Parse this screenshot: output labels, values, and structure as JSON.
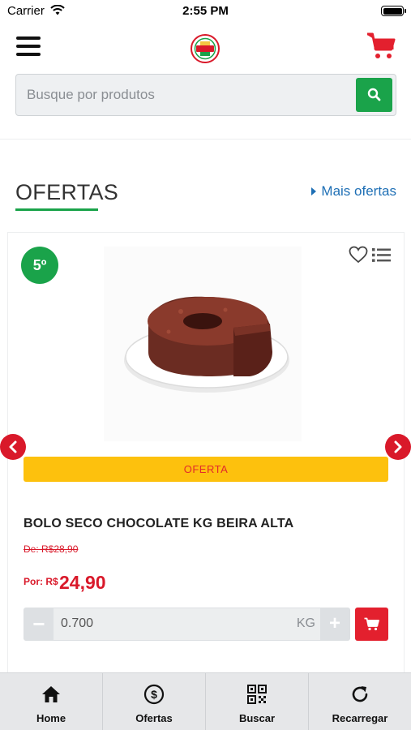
{
  "status_bar": {
    "carrier": "Carrier",
    "time": "2:55 PM"
  },
  "header": {
    "menu_icon": "hamburger-icon",
    "cart_icon": "cart-icon",
    "logo": "store-logo"
  },
  "search": {
    "placeholder": "Busque por produtos",
    "value": ""
  },
  "section": {
    "title": "OFERTAS",
    "more_link": "Mais ofertas"
  },
  "product": {
    "rank": "5º",
    "name": "BOLO SECO CHOCOLATE KG BEIRA ALTA",
    "offer_label": "OFERTA",
    "old_price": "De: R$28,90",
    "price_prefix": "Por: R$",
    "price": "24,90",
    "quantity": "0.700",
    "unit": "KG",
    "minus_label": "−",
    "plus_label": "+"
  },
  "tabs": [
    {
      "label": "Home",
      "icon": "home-icon"
    },
    {
      "label": "Ofertas",
      "icon": "dollar-icon"
    },
    {
      "label": "Buscar",
      "icon": "qr-code-icon"
    },
    {
      "label": "Recarregar",
      "icon": "refresh-icon"
    }
  ],
  "colors": {
    "green": "#1aa34a",
    "red": "#d9192a",
    "yellow": "#fdc10d",
    "link": "#1e6fb5"
  }
}
